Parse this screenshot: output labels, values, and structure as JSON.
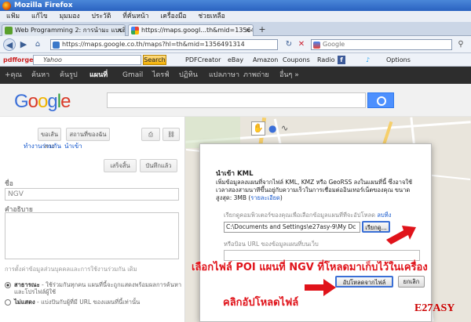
{
  "window": {
    "title": "Mozilla Firefox"
  },
  "menu": [
    "แฟ้ม",
    "แก้ไข",
    "มุมมอง",
    "ประวัติ",
    "ที่คั่นหน้า",
    "เครื่องมือ",
    "ช่วยเหลือ"
  ],
  "tabs": [
    {
      "label": "Web Programming 2: การนำมะ แบบฝึกหัด แผนที่ ...",
      "close": "×"
    },
    {
      "label": "https://maps.googl...th&mid=1356491314",
      "close": "×"
    }
  ],
  "new_tab": "+",
  "address": {
    "url": "https://maps.google.co.th/maps?hl=th&mid=1356491314"
  },
  "search": {
    "placeholder": "Google"
  },
  "toolbar": {
    "brand": "pdfforge",
    "yahoo": "Yahoo",
    "search_btn": "Search",
    "items": [
      "PDFCreator",
      "eBay",
      "Amazon",
      "Coupons",
      "Radio",
      "Options"
    ]
  },
  "gbar": [
    "+คุณ",
    "ค้นหา",
    "ค้นรูป",
    "แผนที่",
    "Gmail",
    "ไดรฟ์",
    "ปฏิทิน",
    "แปลภาษา",
    "ภาพถ่าย",
    "อื่นๆ »"
  ],
  "logo": {
    "letters": [
      "G",
      "o",
      "o",
      "g",
      "l",
      "e"
    ],
    "colors": [
      "#3b6fd8",
      "#d93a28",
      "#f0b400",
      "#3b6fd8",
      "#2f9b3a",
      "#d93a28"
    ]
  },
  "sidebar": {
    "btn_directions": "ขอเส้นทาง",
    "btn_myplaces": "สถานที่ของฉัน",
    "links": [
      "ทำงานร่วมกัน",
      "นำเข้า"
    ],
    "btn_done": "เสร็จสิ้น",
    "btn_save": "บันทึกแล้ว",
    "title_label": "ชื่อ",
    "title_value": "NGV",
    "desc_label": "คำอธิบาย",
    "privacy_label": "การตั้งค่าข้อมูลส่วนบุคคลและการใช้งานร่วมกัน เดิม",
    "public_title": "สาธารณะ",
    "public_desc": " - ใช้ร่วมกันทุกคน แผนที่นี้จะถูกแสดงพร้อมผลการค้นหาและโปรไฟล์ผู้ใช้",
    "unlisted_title": "ไม่แสดง",
    "unlisted_desc": " - แบ่งปันกับผู้ที่มี URL ของแผนที่นี้เท่านั้น"
  },
  "dialog": {
    "title": "นำเข้า KML",
    "desc": "เพิ่มข้อมูลลงแผนที่จากไฟล์ KML, KMZ หรือ GeoRSS ลงในแผนที่นี้ ซึ่งอาจใช้เวลาสองสามนาทีขึ้นอยู่กับความเร็วในการเชื่อมต่ออินเทอร์เน็ตของคุณ ขนาดสูงสุด: 3MB (",
    "desc_link": "รายละเอียด",
    "desc_end": ")",
    "file_label": "เรียกดูคอมพิวเตอร์ของคุณเพื่อเลือกข้อมูลแผนที่ที่จะอัปโหลด",
    "remove_link": "ลบทิ้ง",
    "file_path": "C:\\Documents and Settings\\e27asy-9\\My Dc",
    "browse_btn": "เรียกดู...",
    "url_label": "หรือป้อน URL ของข้อมูลแผนที่บนเว็บ",
    "upload_btn": "อัปโหลดจากไฟล์",
    "cancel_btn": "ยกเลิก"
  },
  "annotations": {
    "select_file": "เลือกไฟล์ POI แผนที่ NGV ที่โหลดมาเก็บไว้ในเครื่อง",
    "click_upload": "คลิกอัปโหลดไฟล์",
    "watermark": "E27ASY"
  },
  "colors": {
    "accent": "#4d90fe",
    "annotation": "#e0131a",
    "map_bg": "#e9e5dc"
  }
}
